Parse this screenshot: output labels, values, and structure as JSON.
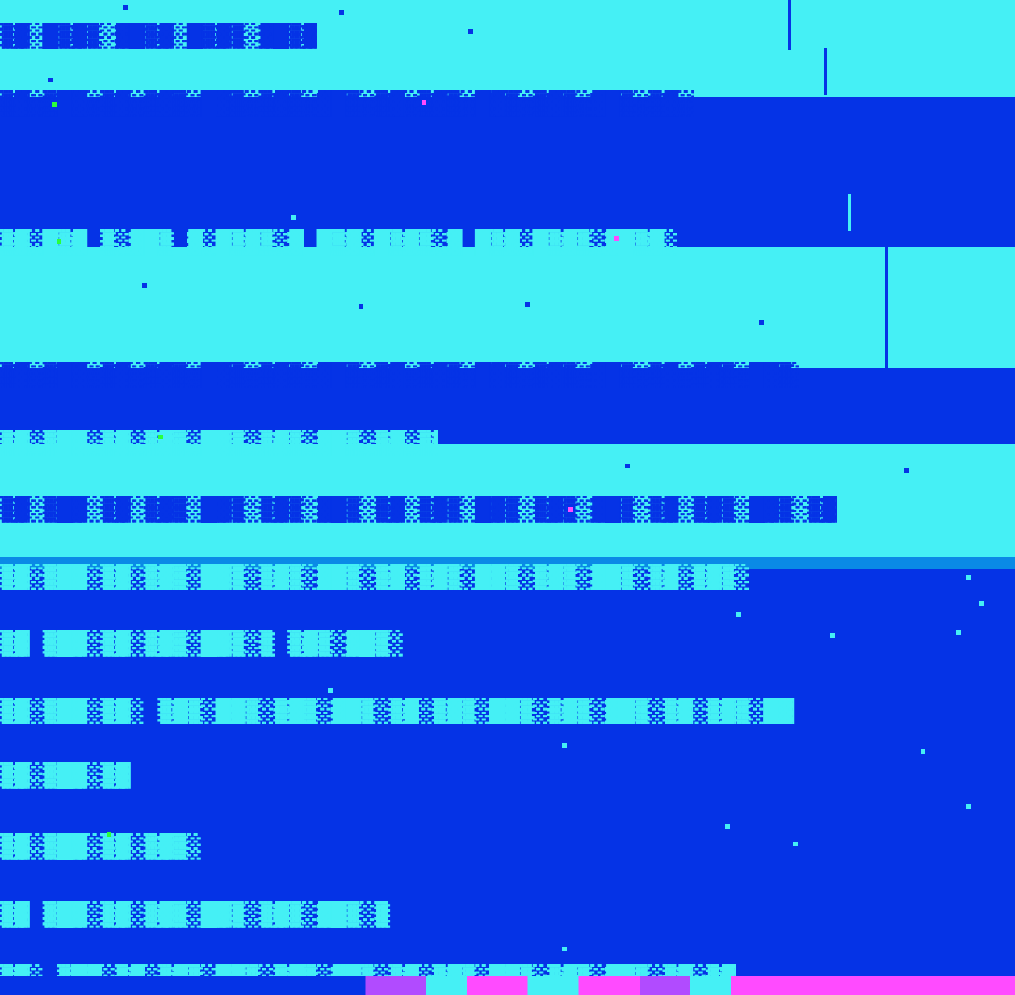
{
  "screen": {
    "lines": [
      {
        "id": "row-1",
        "text": "▒▓░█▒▓▒░▓█▒▓░█▒▓▒░▓█▒▓░█▒▓▒",
        "style": "deep-on-light"
      },
      {
        "id": "row-2",
        "text": "▒▓░▒█▓░▒▓░▒▓▒░█▓▒░▒▓▒░▓█▒░▒▓░▒▓▒░█▓▒░▒▓▒░▓█▒░▒▓░▒▓▒░█▓▒░",
        "style": "deep-on-light"
      },
      {
        "id": "row-3",
        "text": "▒▓░█▒▓  ▒░▓█▒ ▓░█▒▓▒░▓  █▒▓░█▒▓▒░▓ █▒▓░█▒▓▒░▓█▒▓░",
        "style": "light-on-deep"
      },
      {
        "id": "row-4",
        "text": "▒▓░▒█▓░▒▓░▒▓▒░█▓▒░▒▓▒░▓█▒░▒▓░▒▓▒░█▓▒░▒▓▒░▓█▒░▒▓░▒▓▒░█▓▒░",
        "style": "deep-on-light"
      },
      {
        "id": "row-5",
        "text": "▒▓░▒█▓░▒▓░▒▓▒░█▓▒░▒▓▒░▓█▒░▒▓░▒▓",
        "style": "light-on-deep"
      },
      {
        "id": "row-6",
        "text": "▒▓░▒█▓░▒▓░▒▓▒░█▓▒░▒▓▒░▓█▒░▒▓░▒▓▒░█▓▒░▒▓▒░▓█▒░▒▓░▒▓▒░█▓▒░▒▓",
        "style": "deep-on-light"
      },
      {
        "id": "row-7",
        "text": "▒▓░▒█▓░▒▓░▒▓▒░█▓▒░▒▓▒░▓█▒░▒▓░▒▓▒░█▓▒░▒▓▒░▓█▒░▒▓░▒▓▒░",
        "style": "light-on-deep"
      },
      {
        "id": "row-8",
        "text": "▒▓ ▒█▓░▒▓░▒▓▒░█▓▒░▒ ▒▓▒░▓█▒░",
        "style": "light-on-deep"
      },
      {
        "id": "row-9",
        "text": "▒▓░▒█▓░▒▓░ ▒▓▒░█▓▒░▒▓▒░▓█▒░▒▓░▒▓▒░█▓▒░▒▓▒░▓█▒░▒▓░▒▓▒░█▓",
        "style": "light-on-deep"
      },
      {
        "id": "row-10",
        "text": "▒▓░▒█▓░▒▓",
        "style": "light-on-deep"
      },
      {
        "id": "row-11",
        "text": "▒▓░▒█▓░▒▓░▒▓▒░",
        "style": "light-on-deep"
      },
      {
        "id": "row-12",
        "text": "▒▓  ▒█▓░▒▓░▒▓▒░█▓▒░▒▓▒░▓█▒░▒",
        "style": "light-on-deep"
      },
      {
        "id": "row-13",
        "text": "▒▓░  ▒█▓░▒▓░▒▓▒░█▓▒░▒▓▒░▓█▒░▒▓░▒▓▒░█▓▒░▒▓▒░▓█▒░▒▓░▒▓",
        "style": "light-on-deep"
      }
    ]
  },
  "colors": {
    "light": "#45f0f5",
    "deep": "#0533e6",
    "edge": "#0a8ae6",
    "lime": "#2bff3a",
    "pink": "#ff4bff",
    "violet": "#b14bff"
  }
}
